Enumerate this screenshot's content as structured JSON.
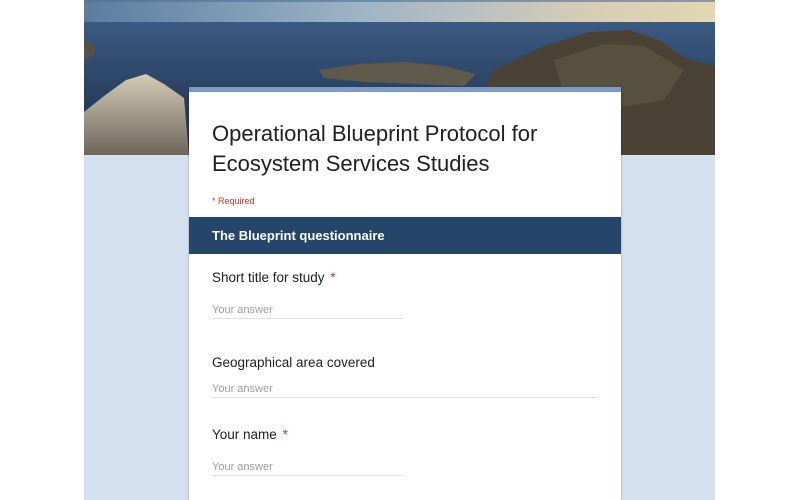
{
  "form": {
    "title": "Operational Blueprint Protocol for Ecosystem Services Studies",
    "required_note": "* Required",
    "section_title": "The Blueprint questionnaire",
    "questions": [
      {
        "label": "Short title for study",
        "required_mark": "*",
        "placeholder": "Your answer"
      },
      {
        "label": "Geographical area covered",
        "required_mark": "",
        "placeholder": "Your answer"
      },
      {
        "label": "Your name",
        "required_mark": "*",
        "placeholder": "Your answer"
      }
    ]
  },
  "colors": {
    "page_background": "#d3e0ee",
    "card_accent": "#7f9cc9",
    "section_header": "#25456b",
    "required": "#d93025"
  },
  "icons": {
    "banner": "coastal-landscape-image"
  }
}
